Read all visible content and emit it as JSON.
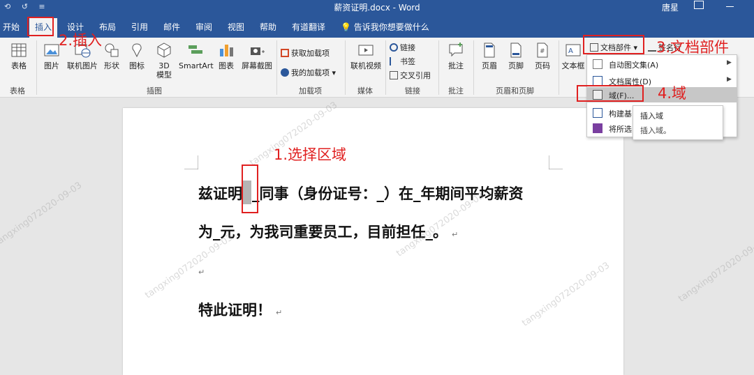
{
  "titlebar": {
    "quick_access": "⟲ ↺ ≡",
    "title": "薪资证明.docx  -  Word",
    "user": "唐星"
  },
  "tabs": [
    {
      "label": "开始"
    },
    {
      "label": "插入"
    },
    {
      "label": "设计"
    },
    {
      "label": "布局"
    },
    {
      "label": "引用"
    },
    {
      "label": "邮件"
    },
    {
      "label": "审阅"
    },
    {
      "label": "视图"
    },
    {
      "label": "帮助"
    },
    {
      "label": "有道翻译"
    }
  ],
  "tellme": "告诉我你想要做什么",
  "ribbon": {
    "table": "表格",
    "picture": "图片",
    "online_picture": "联机图片",
    "shapes": "形状",
    "icons": "图标",
    "model3d_1": "3D",
    "model3d_2": "模型",
    "smartart": "SmartArt",
    "chart": "图表",
    "screenshot": "屏幕截图",
    "get_addins": "获取加载项",
    "my_addins": "我的加载项",
    "online_video": "联机视频",
    "link": "链接",
    "bookmark": "书签",
    "cross_ref": "交叉引用",
    "comment": "批注",
    "header": "页眉",
    "footer": "页脚",
    "page_number": "页码",
    "textbox": "文本框",
    "docparts": "文档部件",
    "signature": "签名行",
    "group_table": "表格",
    "group_illustrations": "插图",
    "group_addins": "加载项",
    "group_media": "媒体",
    "group_links": "链接",
    "group_comments": "批注",
    "group_header_footer": "页眉和页脚"
  },
  "docparts_menu": {
    "autotext": "自动图文集(A)",
    "docprops": "文档属性(D)",
    "field": "域(F)...",
    "building_blocks": "构建基",
    "save_selection": "将所选"
  },
  "submenu": {
    "title": "插入域",
    "desc": "插入域。"
  },
  "document": {
    "line1_a": "兹证明",
    "line1_b": "_同事（身份证号：_）在_年期间平均薪资",
    "line2": "为_元，为我司重要员工，目前担任_。",
    "line3": "",
    "line4": "特此证明！",
    "para_mark": "↵"
  },
  "annotations": {
    "step1": "1.选择区域",
    "step2": "2.插入",
    "step3": "3.文档部件",
    "step4": "4.域",
    "color": "#e02020"
  },
  "watermark": "tangxing072020-09-03",
  "colors": {
    "word_blue": "#2b579a",
    "ribbon_bg": "#f3f3f3",
    "annotation_red": "#e02020"
  }
}
